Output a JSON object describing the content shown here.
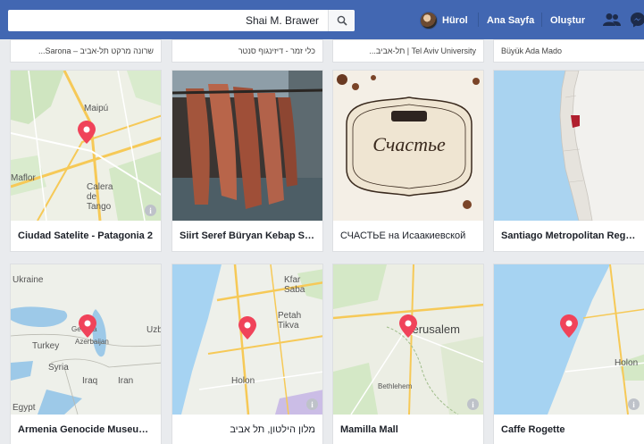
{
  "topbar": {
    "search_value": "Shai M. Brawer",
    "user_name": "Hürol",
    "home_label": "Ana Sayfa",
    "create_label": "Oluştur",
    "brand_color": "#4267b2"
  },
  "top_row": [
    {
      "title": "שרונה מרקט תל-אביב – Sarona..."
    },
    {
      "title": "כלי זמר - דיזינגוף סנטר"
    },
    {
      "title": "Tel Aviv University | תל-אביב..."
    },
    {
      "title": "Büyük Ada Mado"
    }
  ],
  "row1": [
    {
      "title": "Ciudad Satelite - Patagonia 2",
      "map_labels": [
        "Maipú",
        "Calera de Tango",
        "Maflor"
      ]
    },
    {
      "title": "Siirt Seref Büryan Kebap Sal..."
    },
    {
      "title": "СЧАСТЬЕ на Исаакиевской",
      "logo_text": "Счастье"
    },
    {
      "title": "Santiago Metropolitan Region"
    }
  ],
  "row2": [
    {
      "title": "Armenia Genocide Museum, ...",
      "map_labels": [
        "Ukraine",
        "Georgia",
        "Azerbaijan",
        "Turkey",
        "Syria",
        "Iraq",
        "Iran",
        "Uzb",
        "Egypt"
      ]
    },
    {
      "title": "מלון הילטון, תל אביב",
      "map_labels": [
        "Kfar Saba",
        "Petah Tikva",
        "Holon"
      ]
    },
    {
      "title": "Mamilla Mall",
      "map_labels": [
        "Jerusalem",
        "Bethlehem"
      ]
    },
    {
      "title": "Caffe Rogette",
      "map_labels": [
        "Holon"
      ]
    }
  ]
}
